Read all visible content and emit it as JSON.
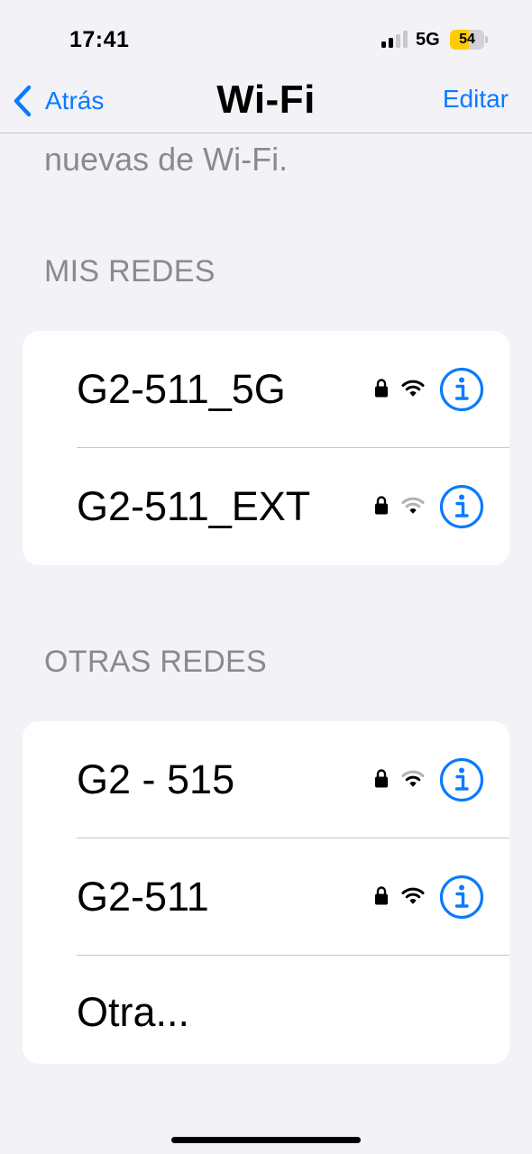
{
  "status_bar": {
    "time": "17:41",
    "network_type": "5G",
    "battery_level": "54",
    "battery_fraction": 0.54,
    "battery_color": "#ffcc00"
  },
  "nav": {
    "back_label": "Atrás",
    "title": "Wi-Fi",
    "edit_label": "Editar",
    "accent_color": "#0a7aff"
  },
  "intro_text": "nuevas de Wi-Fi.",
  "my_networks": {
    "header": "MIS REDES",
    "items": [
      {
        "name": "G2-511_5G",
        "secured": true,
        "signal_bars": 3,
        "icons": [
          "lock-icon",
          "wifi-icon",
          "info-icon"
        ]
      },
      {
        "name": "G2-511_EXT",
        "secured": true,
        "signal_bars": 1,
        "icons": [
          "lock-icon",
          "wifi-icon",
          "info-icon"
        ]
      }
    ]
  },
  "other_networks": {
    "header": "OTRAS REDES",
    "items": [
      {
        "name": "G2 - 515",
        "secured": true,
        "signal_bars": 2,
        "icons": [
          "lock-icon",
          "wifi-icon",
          "info-icon"
        ]
      },
      {
        "name": "G2-511",
        "secured": true,
        "signal_bars": 3,
        "icons": [
          "lock-icon",
          "wifi-icon",
          "info-icon"
        ]
      }
    ],
    "other_label": "Otra..."
  }
}
